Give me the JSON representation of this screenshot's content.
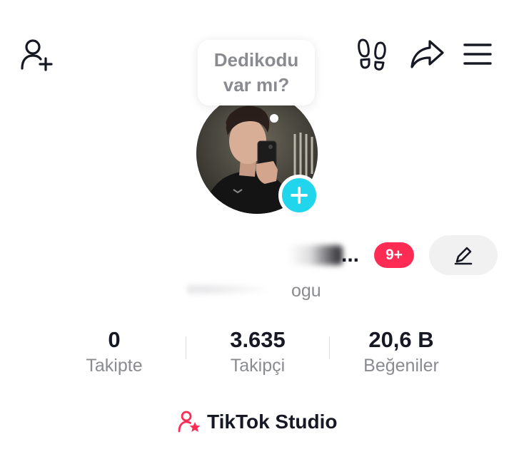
{
  "header": {
    "add_friend_icon": "person-plus-icon",
    "footprint_icon": "footprint-icon",
    "share_icon": "share-arrow-icon",
    "menu_icon": "hamburger-menu-icon"
  },
  "bubble": {
    "line1": "Dedikodu",
    "line2": "var mı?"
  },
  "profile": {
    "avatar_alt": "profile-photo",
    "name_suffix": "...",
    "badge": "9+",
    "username_visible": "ogu"
  },
  "stats": [
    {
      "value": "0",
      "label": "Takipte"
    },
    {
      "value": "3.635",
      "label": "Takipçi"
    },
    {
      "value": "20,6 B",
      "label": "Beğeniler"
    }
  ],
  "studio": {
    "label": "TikTok Studio"
  },
  "colors": {
    "accent_red": "#fe2c55",
    "accent_cyan": "#20d5ec",
    "text_primary": "#161823",
    "text_secondary": "#8a8b91",
    "button_bg": "#f1f1f2"
  }
}
